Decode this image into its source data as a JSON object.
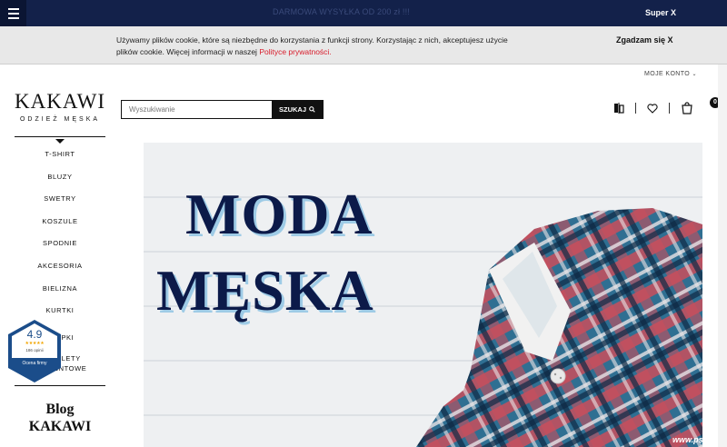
{
  "topbar": {
    "promo": "DARMOWA WYSYŁKA OD 200 zł !!!",
    "super_x": "Super X"
  },
  "cookie": {
    "text_line1": "Używamy plików cookie, które są niezbędne do korzystania z funkcji strony. Korzystając z nich, akceptujesz użycie",
    "text_line2": "plików cookie. Więcej informacji w naszej ",
    "policy_link": "Polityce prywatności.",
    "accept": "Zgadzam się X"
  },
  "header": {
    "account": "MOJE KONTO",
    "logo_main": "KAKAWI",
    "logo_sub": "ODZIEŻ MĘSKA",
    "search_placeholder": "Wyszukiwanie",
    "search_button": "SZUKAJ",
    "cart_count": "0"
  },
  "nav": {
    "items": [
      "T-SHIRT",
      "BLUZY",
      "SWETRY",
      "KOSZULE",
      "SPODNIE",
      "AKCESORIA",
      "BIELIZNA",
      "KURTKI"
    ],
    "partial_1": "CZAPKI",
    "partial_2": "KOMPLETY",
    "partial_3": "PREZENTOWE"
  },
  "rating": {
    "score": "4.9",
    "stars": "★★★★★",
    "count": "186 opinii",
    "label": "Ocena firmy"
  },
  "blog": {
    "line1": "Blog",
    "line2": "KAKAWI"
  },
  "hero": {
    "line1": "MODA",
    "line2": "MĘSKA"
  },
  "watermark": "www.psji.pl",
  "icons": [
    "menu-icon",
    "compare-icon",
    "heart-icon",
    "cart-icon",
    "search-icon",
    "chevron-down-icon"
  ]
}
